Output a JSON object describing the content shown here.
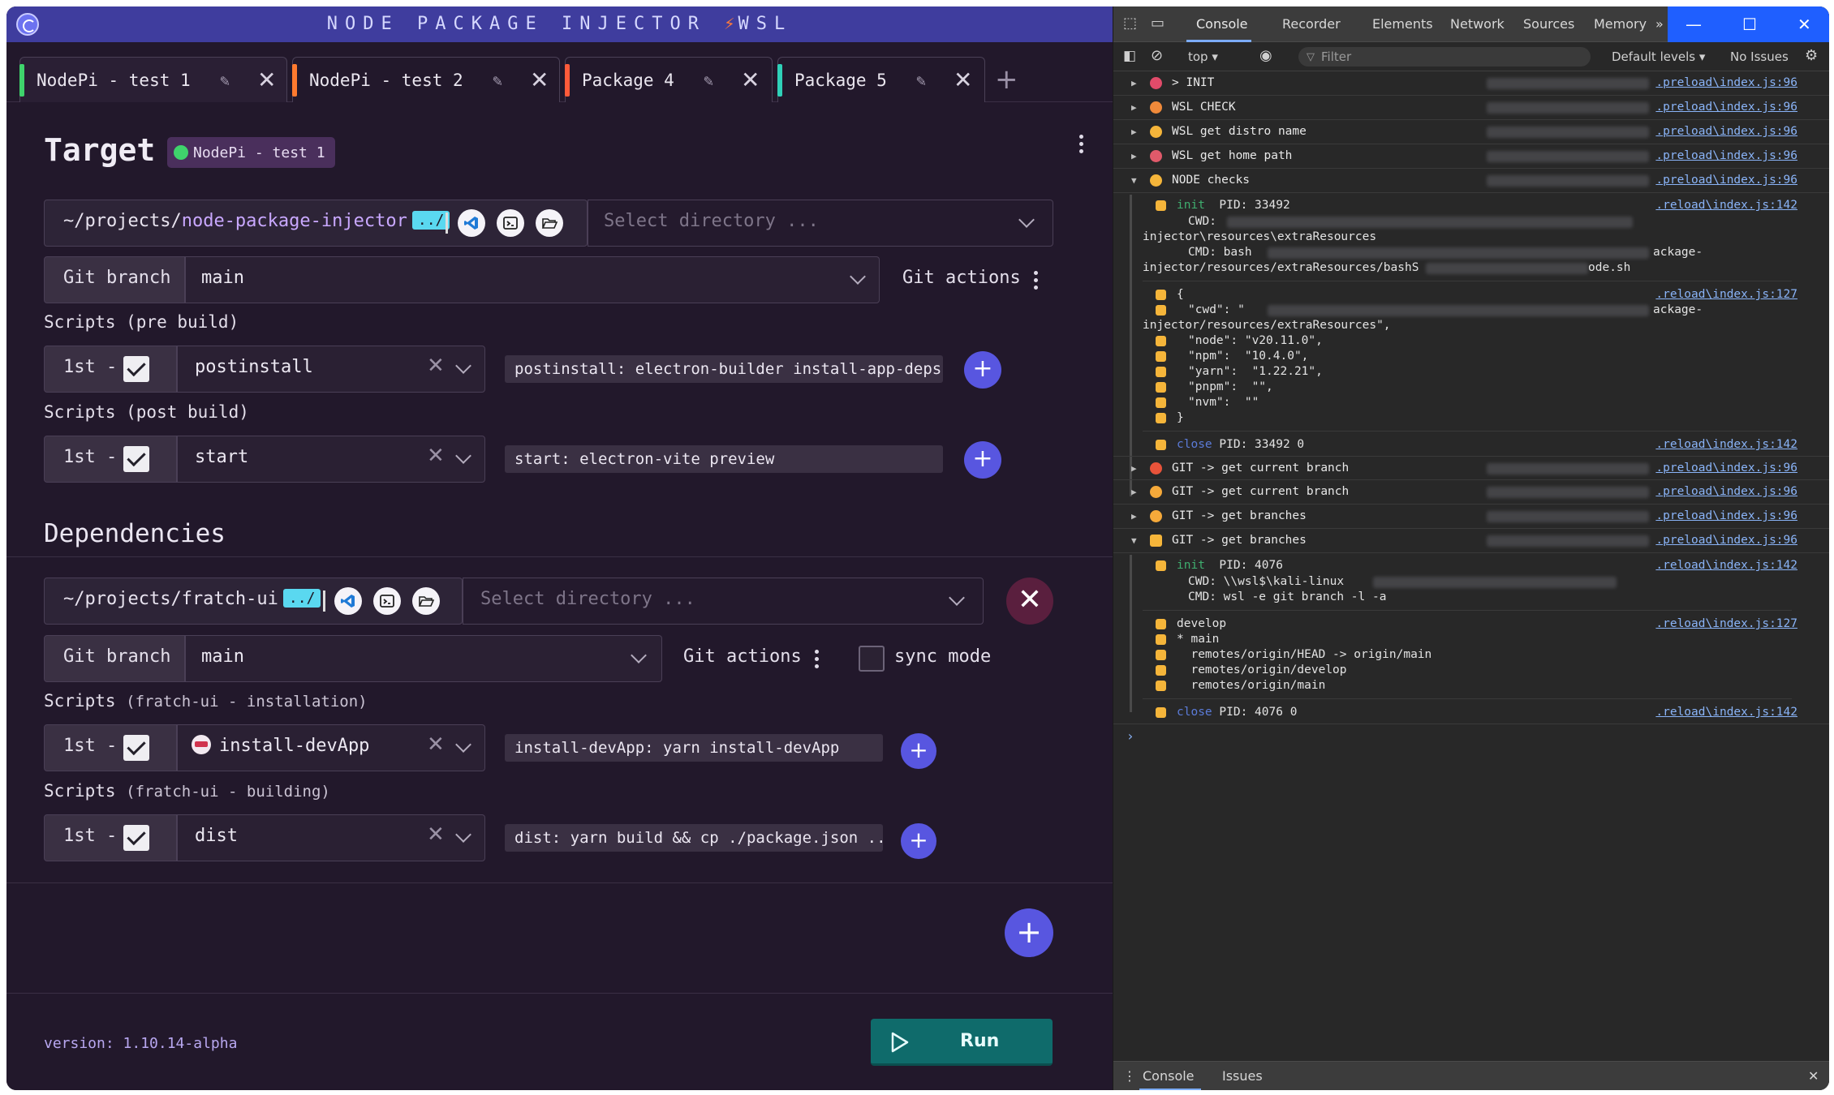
{
  "app": {
    "title": "NODE PACKAGE INJECTOR",
    "title_suffix": "WSL",
    "tabs": [
      {
        "label": "NodePi - test 1",
        "color": "#3fd36c"
      },
      {
        "label": "NodePi - test 2",
        "color": "#ff7a2f"
      },
      {
        "label": "Package 4",
        "color": "#ff5a3a"
      },
      {
        "label": "Package 5",
        "color": "#2fd0b8"
      }
    ],
    "target": {
      "heading": "Target",
      "badge": "NodePi - test 1",
      "path_prefix": "~/projects/",
      "path_name": "node-package-injector",
      "dotdot": "../",
      "dir_placeholder": "Select directory ...",
      "git_branch_label": "Git branch",
      "git_branch_value": "main",
      "git_actions_label": "Git actions",
      "scripts_pre_label": "Scripts (pre build)",
      "scripts_pre": {
        "order": "1st -",
        "name": "postinstall",
        "command": "postinstall: electron-builder install-app-deps"
      },
      "scripts_post_label": "Scripts (post build)",
      "scripts_post": {
        "order": "1st -",
        "name": "start",
        "command": "start: electron-vite preview"
      }
    },
    "dependencies": {
      "heading": "Dependencies",
      "path": "~/projects/fratch-ui",
      "dotdot": "../",
      "dir_placeholder": "Select directory ...",
      "git_branch_label": "Git branch",
      "git_branch_value": "main",
      "git_actions_label": "Git actions",
      "sync_mode_label": "sync mode",
      "scripts_install_label": "Scripts",
      "scripts_install_sub": "(fratch-ui - installation)",
      "scripts_install": {
        "order": "1st -",
        "name": "install-devApp",
        "command": "install-devApp: yarn install-devApp"
      },
      "scripts_build_label": "Scripts",
      "scripts_build_sub": "(fratch-ui - building)",
      "scripts_build": {
        "order": "1st -",
        "name": "dist",
        "command": "dist: yarn build && cp ./package.json ..."
      }
    },
    "version": "version: 1.10.14-alpha",
    "run_label": "Run",
    "accent": "#5856e0",
    "run_color": "#0f6b6b"
  },
  "devtools": {
    "tabs": [
      "Console",
      "Recorder",
      "Elements",
      "Network",
      "Sources",
      "Memory"
    ],
    "toolbar": {
      "context": "top",
      "filter_placeholder": "Filter",
      "levels": "Default levels",
      "issues": "No Issues"
    },
    "rows": [
      {
        "msg": "> INIT",
        "src": ".preload\\index.js:96",
        "color": "#e14b6a",
        "open": false
      },
      {
        "msg": "WSL CHECK",
        "src": ".preload\\index.js:96",
        "color": "#f08a3a",
        "open": false
      },
      {
        "msg": "WSL get distro name",
        "src": ".preload\\index.js:96",
        "color": "#f5b53a",
        "open": false
      },
      {
        "msg": "WSL get home path",
        "src": ".preload\\index.js:96",
        "color": "#e05a6a",
        "open": false
      },
      {
        "msg": "NODE checks",
        "src": ".preload\\index.js:96",
        "color": "#f5b53a",
        "open": true
      }
    ],
    "node_group": {
      "init_label": "init",
      "init_pid": "PID: 33492",
      "init_src": ".reload\\index.js:142",
      "cwd_label": "CWD:",
      "cwd_tail": "injector\\resources\\extraResources",
      "cmd_label": "CMD: bash",
      "cmd_tail": "ackage-",
      "cmd_line2": "injector/resources/extraResources/bashS",
      "cmd_line2_end": "ode.sh",
      "json_src": ".reload\\index.js:127",
      "json_open": "{",
      "json_cwd": "\"cwd\": \"",
      "json_cwd_end": "ackage-",
      "json_cwd_line2": "injector/resources/extraResources\",",
      "json_node": "\"node\": \"v20.11.0\",",
      "json_npm": "\"npm\":  \"10.4.0\",",
      "json_yarn": "\"yarn\":  \"1.22.21\",",
      "json_pnpm": "\"pnpm\":  \"\",",
      "json_nvm": "\"nvm\":  \"\"",
      "json_close": "}",
      "close_label": "close",
      "close_pid": "PID: 33492 0",
      "close_src": ".reload\\index.js:142"
    },
    "git_rows": [
      {
        "msg": "GIT -> get current branch",
        "src": ".preload\\index.js:96",
        "color": "#e8533a",
        "open": false
      },
      {
        "msg": "GIT -> get current branch",
        "src": ".preload\\index.js:96",
        "color": "#f5a93a",
        "open": false
      },
      {
        "msg": "GIT -> get branches",
        "src": ".preload\\index.js:96",
        "color": "#f5a93a",
        "open": false
      },
      {
        "msg": "GIT -> get branches",
        "src": ".preload\\index.js:96",
        "color": "#f5b53a",
        "open": true
      }
    ],
    "git_group": {
      "init_label": "init",
      "init_pid": "PID: 4076",
      "init_src": ".reload\\index.js:142",
      "cwd": "CWD: \\\\wsl$\\kali-linux",
      "cmd": "CMD: wsl -e git branch -l -a",
      "out_src": ".reload\\index.js:127",
      "out": [
        "develop",
        "* main",
        "  remotes/origin/HEAD -> origin/main",
        "  remotes/origin/develop",
        "  remotes/origin/main"
      ],
      "close_label": "close",
      "close_pid": "PID: 4076 0",
      "close_src": ".reload\\index.js:142"
    },
    "bottom_tabs": [
      "Console",
      "Issues"
    ]
  }
}
